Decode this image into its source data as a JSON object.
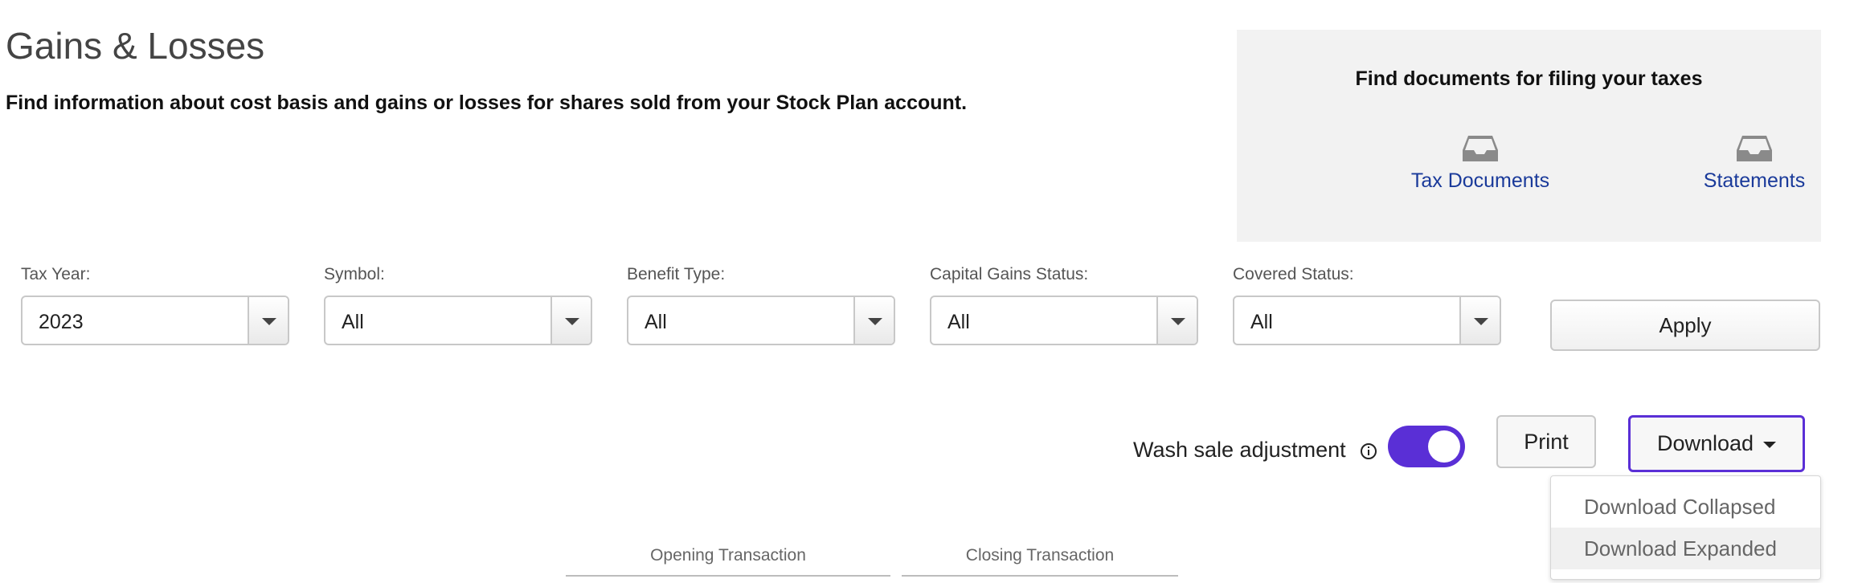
{
  "header": {
    "title": "Gains & Losses",
    "subtitle": "Find information about cost basis and gains or losses for shares sold from your Stock Plan account."
  },
  "docs_panel": {
    "title": "Find documents for filing your taxes",
    "links": [
      {
        "label": "Tax Documents",
        "icon": "inbox-tray-icon"
      },
      {
        "label": "Statements",
        "icon": "inbox-tray-icon"
      }
    ]
  },
  "filters": [
    {
      "label": "Tax Year:",
      "value": "2023"
    },
    {
      "label": "Symbol:",
      "value": "All"
    },
    {
      "label": "Benefit Type:",
      "value": "All"
    },
    {
      "label": "Capital Gains Status:",
      "value": "All"
    },
    {
      "label": "Covered Status:",
      "value": "All"
    }
  ],
  "apply_label": "Apply",
  "wash_sale": {
    "label": "Wash sale adjustment",
    "enabled": true,
    "info_icon": "info-icon"
  },
  "actions": {
    "print_label": "Print",
    "download_label": "Download"
  },
  "download_menu": {
    "items": [
      "Download Collapsed",
      "Download Expanded"
    ],
    "highlighted_index": 1
  },
  "table": {
    "group_headers": [
      "Opening Transaction",
      "Closing Transaction"
    ]
  },
  "colors": {
    "accent": "#5a2fd6",
    "link": "#1a3a9a",
    "panel_bg": "#f2f2f2"
  }
}
